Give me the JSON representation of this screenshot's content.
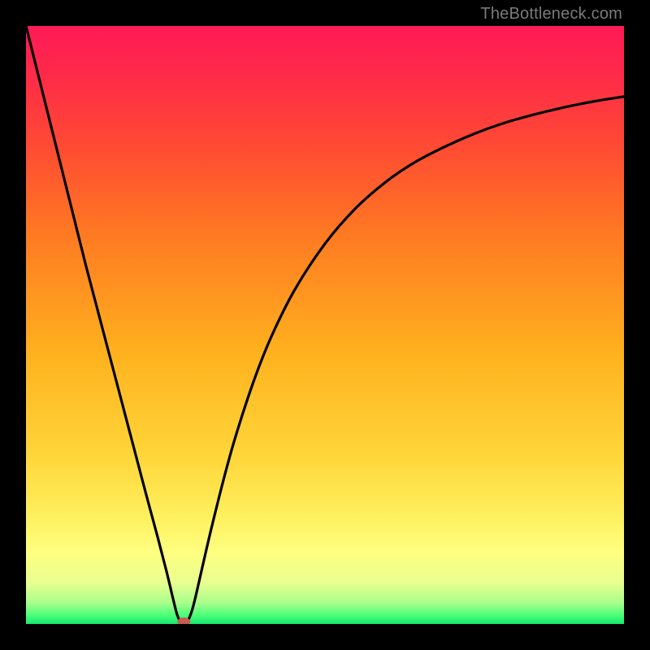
{
  "watermark": "TheBottleneck.com",
  "chart_data": {
    "type": "line",
    "title": "",
    "xlabel": "",
    "ylabel": "",
    "xlim": [
      0,
      100
    ],
    "ylim": [
      0,
      100
    ],
    "background_gradient": {
      "stops": [
        {
          "offset": 0.0,
          "color": "#ff1a55"
        },
        {
          "offset": 0.08,
          "color": "#ff2a4a"
        },
        {
          "offset": 0.2,
          "color": "#ff4a33"
        },
        {
          "offset": 0.35,
          "color": "#ff7a22"
        },
        {
          "offset": 0.55,
          "color": "#ffb21e"
        },
        {
          "offset": 0.72,
          "color": "#ffd63a"
        },
        {
          "offset": 0.82,
          "color": "#fff05e"
        },
        {
          "offset": 0.88,
          "color": "#ffff80"
        },
        {
          "offset": 0.93,
          "color": "#e9ff90"
        },
        {
          "offset": 0.965,
          "color": "#a8ff8c"
        },
        {
          "offset": 0.985,
          "color": "#4dff7a"
        },
        {
          "offset": 1.0,
          "color": "#15e86e"
        }
      ]
    },
    "series": [
      {
        "name": "bottleneck-curve",
        "type": "line",
        "points": [
          {
            "x": 0.0,
            "y": 100.0
          },
          {
            "x": 2.0,
            "y": 92.0
          },
          {
            "x": 4.0,
            "y": 84.0
          },
          {
            "x": 6.0,
            "y": 76.0
          },
          {
            "x": 8.0,
            "y": 68.0
          },
          {
            "x": 10.0,
            "y": 60.0
          },
          {
            "x": 12.0,
            "y": 52.4
          },
          {
            "x": 14.0,
            "y": 44.8
          },
          {
            "x": 16.0,
            "y": 37.2
          },
          {
            "x": 18.0,
            "y": 29.6
          },
          {
            "x": 20.0,
            "y": 22.0
          },
          {
            "x": 22.0,
            "y": 14.6
          },
          {
            "x": 23.5,
            "y": 8.8
          },
          {
            "x": 24.5,
            "y": 4.6
          },
          {
            "x": 25.2,
            "y": 1.8
          },
          {
            "x": 25.8,
            "y": 0.4
          },
          {
            "x": 26.4,
            "y": 0.0
          },
          {
            "x": 27.0,
            "y": 0.4
          },
          {
            "x": 27.8,
            "y": 2.4
          },
          {
            "x": 28.6,
            "y": 5.6
          },
          {
            "x": 29.6,
            "y": 10.0
          },
          {
            "x": 31.0,
            "y": 16.0
          },
          {
            "x": 33.0,
            "y": 24.0
          },
          {
            "x": 35.0,
            "y": 31.2
          },
          {
            "x": 38.0,
            "y": 40.4
          },
          {
            "x": 41.0,
            "y": 48.0
          },
          {
            "x": 45.0,
            "y": 56.0
          },
          {
            "x": 50.0,
            "y": 63.6
          },
          {
            "x": 55.0,
            "y": 69.4
          },
          {
            "x": 60.0,
            "y": 73.8
          },
          {
            "x": 65.0,
            "y": 77.2
          },
          {
            "x": 70.0,
            "y": 79.8
          },
          {
            "x": 75.0,
            "y": 82.0
          },
          {
            "x": 80.0,
            "y": 83.8
          },
          {
            "x": 85.0,
            "y": 85.2
          },
          {
            "x": 90.0,
            "y": 86.4
          },
          {
            "x": 95.0,
            "y": 87.4
          },
          {
            "x": 100.0,
            "y": 88.2
          }
        ]
      }
    ],
    "marker": {
      "name": "minimum-marker",
      "x": 26.4,
      "y": 0.0,
      "color": "#c85a52",
      "rx": 8,
      "ry": 5
    }
  }
}
